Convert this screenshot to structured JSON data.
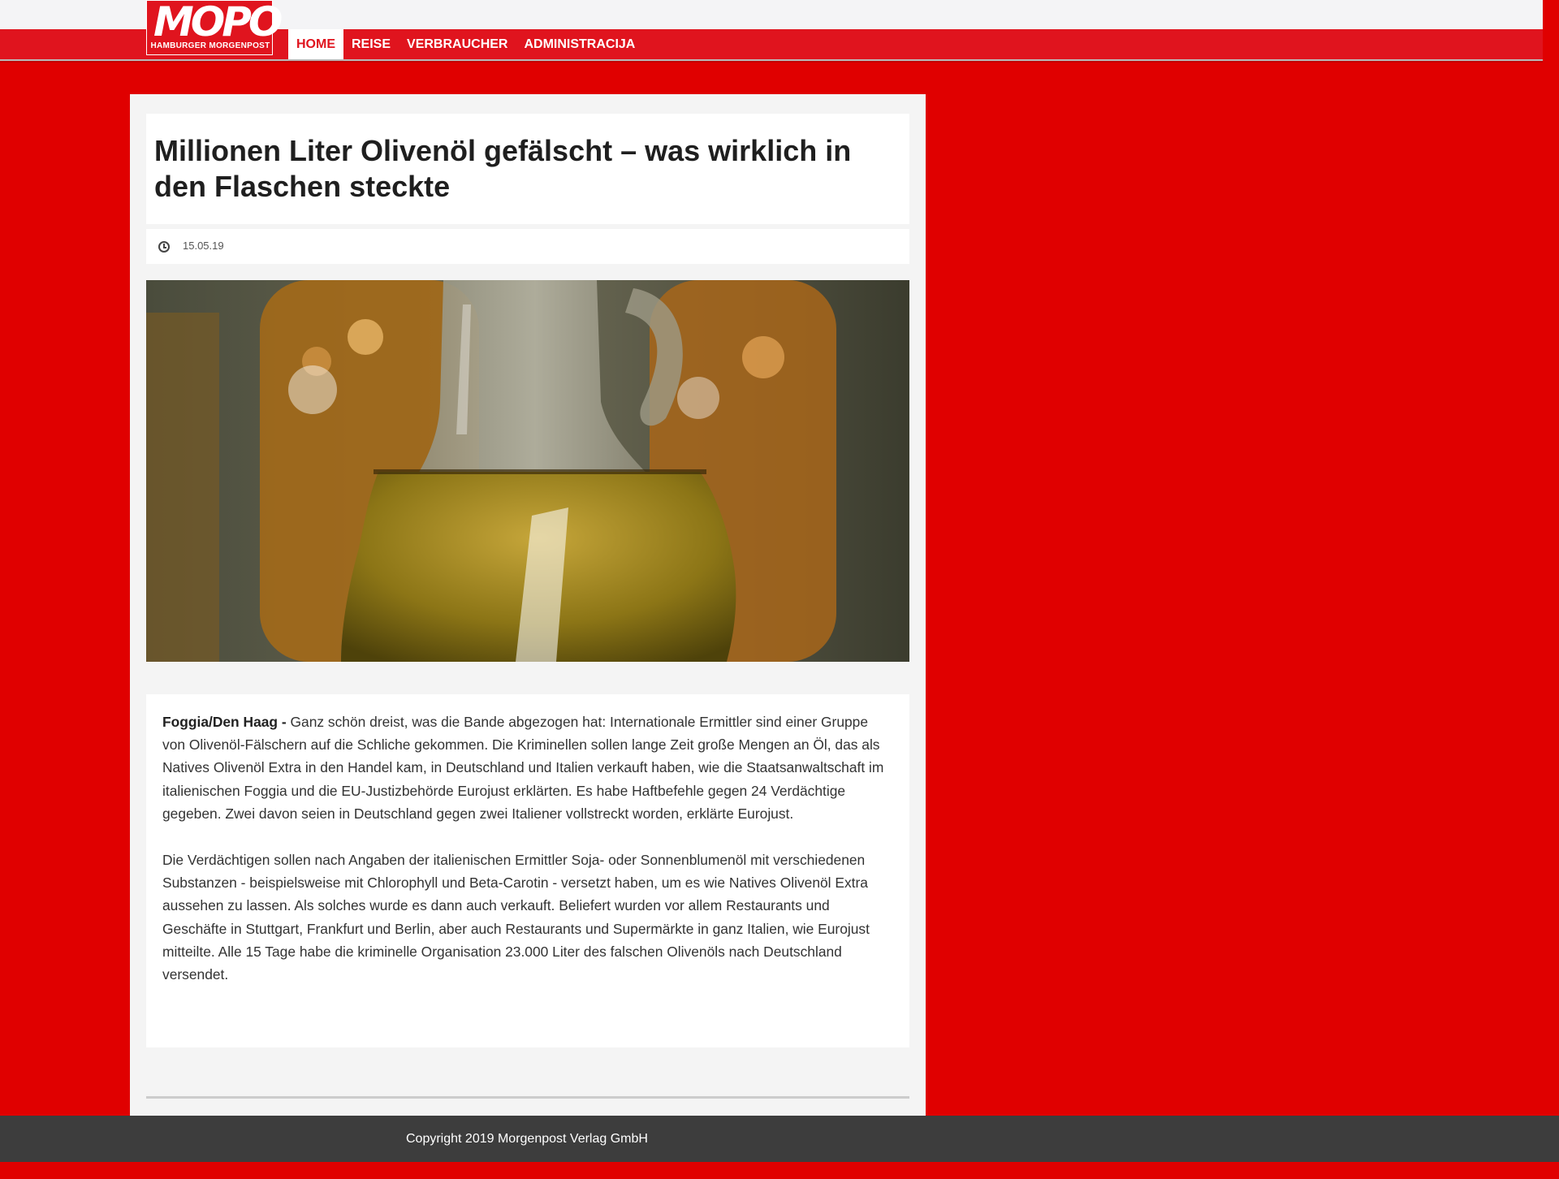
{
  "header": {
    "logo_word": "MOPO",
    "logo_sub": "HAMBURGER MORGENPOST",
    "nav": [
      {
        "label": "HOME",
        "active": true
      },
      {
        "label": "REISE",
        "active": false
      },
      {
        "label": "VERBRAUCHER",
        "active": false
      },
      {
        "label": "ADMINISTRACIJA",
        "active": false
      }
    ]
  },
  "article": {
    "title": "Millionen Liter Olivenöl gefälscht – was wirklich in den Flaschen steckte",
    "date": "15.05.19",
    "lead": "Foggia/Den Haag -",
    "paragraph1": "Ganz schön dreist, was die Bande abgezogen hat: Internationale Ermittler sind einer Gruppe von Olivenöl-Fälschern auf die Schliche gekommen. Die Kriminellen sollen lange Zeit große Mengen an Öl, das als Natives Olivenöl Extra in den Handel kam, in Deutschland und Italien verkauft haben, wie die Staatsanwaltschaft im italienischen Foggia und die EU-Justizbehörde Eurojust erklärten. Es habe Haftbefehle gegen 24 Verdächtige gegeben. Zwei davon seien in Deutschland gegen zwei Italiener vollstreckt worden, erklärte Eurojust.",
    "paragraph2": "Die Verdächtigen sollen nach Angaben der italienischen Ermittler Soja- oder Sonnenblumenöl mit verschiedenen Substanzen - beispielsweise mit Chlorophyll und Beta-Carotin - versetzt haben, um es wie Natives Olivenöl Extra aussehen zu lassen. Als solches wurde es dann auch verkauft. Beliefert wurden vor allem Restaurants und Geschäfte in Stuttgart, Frankfurt und Berlin, aber auch Restaurants und Supermärkte in ganz Italien, wie Eurojust mitteilte. Alle 15 Tage habe die kriminelle Organisation 23.000 Liter des falschen Olivenöls nach Deutschland versendet."
  },
  "footer": {
    "copyright": "Copyright 2019 Morgenpost Verlag GmbH"
  },
  "colors": {
    "brand_red": "#e0141e",
    "page_red": "#e00000",
    "footer_gray": "#3d3d3d"
  }
}
